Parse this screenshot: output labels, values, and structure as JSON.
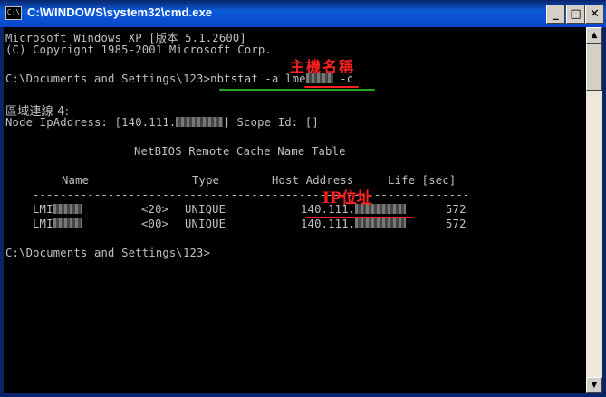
{
  "window": {
    "icon_text": "C:\\",
    "title": "C:\\WINDOWS\\system32\\cmd.exe",
    "buttons": {
      "minimize": "_",
      "maximize": "□",
      "close": "✕"
    }
  },
  "console": {
    "line1": "Microsoft Windows XP [版本 5.1.2600]",
    "line2": "(C) Copyright 1985-2001 Microsoft Corp.",
    "prompt_path": "C:\\Documents and Settings\\123>",
    "cmd_part1": "nbtstat -a ",
    "cmd_host": "lme",
    "cmd_part2": " -c",
    "adapter": "區域連線 4:",
    "node_prefix": "Node IpAddress: [140.111.",
    "node_suffix": "] Scope Id: []",
    "table_title": "NetBIOS Remote Cache Name Table",
    "headers": {
      "name": "Name",
      "type": "Type",
      "host": "Host Address",
      "life": "Life [sec]"
    },
    "divider": "----------------------------------------------------------------",
    "rows": [
      {
        "name": "LMI",
        "code": "<20>",
        "type": "UNIQUE",
        "addr": "140.111.",
        "life": "572"
      },
      {
        "name": "LMI",
        "code": "<00>",
        "type": "UNIQUE",
        "addr": "140.111.",
        "life": "572"
      }
    ],
    "final_prompt": "C:\\Documents and Settings\\123>"
  },
  "annotations": {
    "host_label": "主機名稱",
    "ip_label": "IP位址",
    "host_color": "#ff2020",
    "green_color": "#22aa22"
  },
  "scrollbar": {
    "up_arrow": "▲",
    "down_arrow": "▼"
  }
}
